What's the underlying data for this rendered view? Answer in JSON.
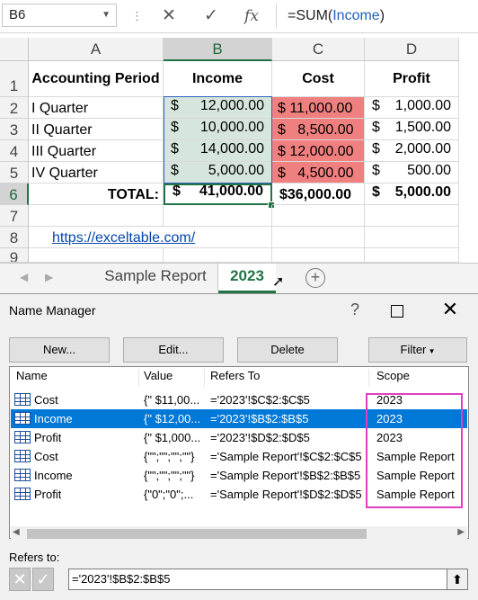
{
  "formula_bar": {
    "name_box": "B6",
    "cancel_glyph": "✕",
    "enter_glyph": "✓",
    "fx_label": "fx",
    "formula_prefix": "=SUM(",
    "formula_ref": "Income",
    "formula_suffix": ")"
  },
  "sheet": {
    "columns": [
      "A",
      "B",
      "C",
      "D"
    ],
    "rows": [
      "1",
      "2",
      "3",
      "4",
      "5",
      "6",
      "7",
      "8",
      "9"
    ],
    "header": {
      "period": "Accounting Period",
      "income": "Income",
      "cost": "Cost",
      "profit": "Profit"
    },
    "data": [
      {
        "period": "I Quarter",
        "income": "12,000.00",
        "cost": "$ 11,000.00",
        "profit": "1,000.00"
      },
      {
        "period": "II Quarter",
        "income": "10,000.00",
        "cost": "$   8,500.00",
        "profit": "1,500.00"
      },
      {
        "period": "III Quarter",
        "income": "14,000.00",
        "cost": "$ 12,000.00",
        "profit": "2,000.00"
      },
      {
        "period": "IV Quarter",
        "income": "5,000.00",
        "cost": "$   4,500.00",
        "profit": "500.00"
      }
    ],
    "currency": "$",
    "total_label": "TOTAL:",
    "total_income": "41,000.00",
    "total_cost": "$36,000.00",
    "total_profit": "5,000.00",
    "link": "https://exceltable.com/"
  },
  "tabs": {
    "items": [
      "Sample Report",
      "2023"
    ],
    "active": "2023",
    "add_glyph": "+"
  },
  "dialog": {
    "title": "Name Manager",
    "buttons": {
      "new": "New...",
      "edit": "Edit...",
      "delete": "Delete",
      "filter": "Filter"
    },
    "columns": [
      "Name",
      "Value",
      "Refers To",
      "Scope"
    ],
    "rows": [
      {
        "name": "Cost",
        "value": "{\" $11,00...",
        "refers": "='2023'!$C$2:$C$5",
        "scope": "2023"
      },
      {
        "name": "Income",
        "value": "{\" $12,00...",
        "refers": "='2023'!$B$2:$B$5",
        "scope": "2023"
      },
      {
        "name": "Profit",
        "value": "{\" $1,000...",
        "refers": "='2023'!$D$2:$D$5",
        "scope": "2023"
      },
      {
        "name": "Cost",
        "value": "{\"\";\"\";\"\";\"\"}",
        "refers": "='Sample Report'!$C$2:$C$5",
        "scope": "Sample Report"
      },
      {
        "name": "Income",
        "value": "{\"\";\"\";\"\";\"\"}",
        "refers": "='Sample Report'!$B$2:$B$5",
        "scope": "Sample Report"
      },
      {
        "name": "Profit",
        "value": "{\"0\";\"0\";...",
        "refers": "='Sample Report'!$D$2:$D$5",
        "scope": "Sample Report"
      }
    ],
    "selected_row": 1,
    "refers_to_label": "Refers to:",
    "refers_to_value": "='2023'!$B$2:$B$5",
    "accent_color": "#0078d7",
    "highlight_color": "#e040c0"
  }
}
